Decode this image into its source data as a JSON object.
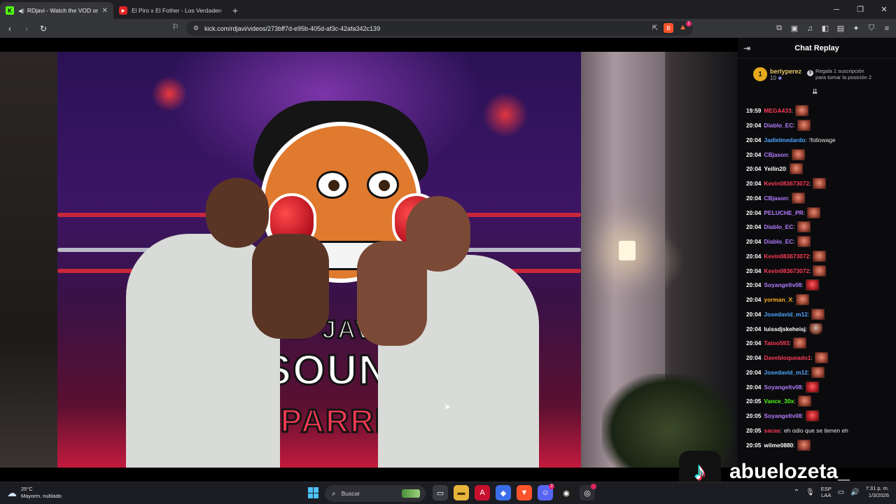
{
  "browser": {
    "tabs": [
      {
        "title": "RDjavi - Watch the VOD on K",
        "favicon": "kick-icon",
        "active": true,
        "audio": true
      },
      {
        "title": "El Piro x El Fother - Los Verdaderos C",
        "favicon": "youtube-icon",
        "active": false
      }
    ],
    "url": "kick.com/rdjavi/videos/273bff7d-e95b-405d-af3c-42afa342c139",
    "brave_badge": "1"
  },
  "video": {
    "banner_text_1": "RD JAVI",
    "banner_text_2": "SOUNDE",
    "banner_text_3": "SPARRIN"
  },
  "chat": {
    "title": "Chat Replay",
    "top_gifter": {
      "rank": "1",
      "name": "berlyperez",
      "count": "10"
    },
    "promo": "Regala 1 suscripción para tomar la posición 2",
    "messages": [
      {
        "time": "19:59",
        "user": "MEGA433",
        "color": "#ff3b55",
        "text": "",
        "emote": "face"
      },
      {
        "time": "20:04",
        "user": "Diablo_EC",
        "color": "#b57cff",
        "text": "",
        "emote": "face"
      },
      {
        "time": "20:04",
        "user": "Jadielmedardo",
        "color": "#4da6ff",
        "text": "!followage",
        "emote": ""
      },
      {
        "time": "20:04",
        "user": "CBjason",
        "color": "#b57cff",
        "text": "",
        "emote": "face"
      },
      {
        "time": "20:04",
        "user": "Yeilin20",
        "color": "#ffffff",
        "text": "",
        "emote": "face"
      },
      {
        "time": "20:04",
        "user": "Kevin083673072",
        "color": "#ff3b55",
        "text": "",
        "emote": "face"
      },
      {
        "time": "20:04",
        "user": "CBjason",
        "color": "#b57cff",
        "text": "",
        "emote": "face"
      },
      {
        "time": "20:04",
        "user": "PELUCHE_PR",
        "color": "#b57cff",
        "text": "",
        "emote": "face"
      },
      {
        "time": "20:04",
        "user": "Diablo_EC",
        "color": "#b57cff",
        "text": "",
        "emote": "face"
      },
      {
        "time": "20:04",
        "user": "Diablo_EC",
        "color": "#b57cff",
        "text": "",
        "emote": "face"
      },
      {
        "time": "20:04",
        "user": "Kevin083673072",
        "color": "#ff3b55",
        "text": "",
        "emote": "face"
      },
      {
        "time": "20:04",
        "user": "Kevin083673072",
        "color": "#ff3b55",
        "text": "",
        "emote": "face"
      },
      {
        "time": "20:04",
        "user": "Soyangeltv08",
        "color": "#b57cff",
        "text": "",
        "emote": "red"
      },
      {
        "time": "20:04",
        "user": "yorman_X",
        "color": "#ffb020",
        "text": "",
        "emote": "face"
      },
      {
        "time": "20:04",
        "user": "Josedavid_m12",
        "color": "#4da6ff",
        "text": "",
        "emote": "face"
      },
      {
        "time": "20:04",
        "user": "luissdjskeheisj",
        "color": "#ffffff",
        "text": "",
        "emote": "fig"
      },
      {
        "time": "20:04",
        "user": "Tatoo593",
        "color": "#ff3b55",
        "text": "",
        "emote": "face"
      },
      {
        "time": "20:04",
        "user": "Davebloqueado1",
        "color": "#ff3b55",
        "text": "",
        "emote": "face"
      },
      {
        "time": "20:04",
        "user": "Josedavid_m12",
        "color": "#4da6ff",
        "text": "",
        "emote": "face"
      },
      {
        "time": "20:04",
        "user": "Soyangeltv08",
        "color": "#b57cff",
        "text": "",
        "emote": "red"
      },
      {
        "time": "20:05",
        "user": "Vance_30x",
        "color": "#53fc18",
        "text": "",
        "emote": "face"
      },
      {
        "time": "20:05",
        "user": "Soyangeltv08",
        "color": "#b57cff",
        "text": "",
        "emote": "red"
      },
      {
        "time": "20:05",
        "user": "sacas",
        "color": "#ff3b55",
        "text": "eh odio que se tienen eh",
        "emote": ""
      },
      {
        "time": "20:05",
        "user": "wilme0880",
        "color": "#ffffff",
        "text": "",
        "emote": "face"
      }
    ]
  },
  "overlay": {
    "handle": "abuelozeta_"
  },
  "taskbar": {
    "temperature": "25°C",
    "condition": "Mayorm. nublado",
    "search_placeholder": "Buscar",
    "lang_1": "ESP",
    "lang_2": "LAA",
    "time": "7:31 p. m.",
    "date": "1/3/2026",
    "discord_badge": "2"
  }
}
